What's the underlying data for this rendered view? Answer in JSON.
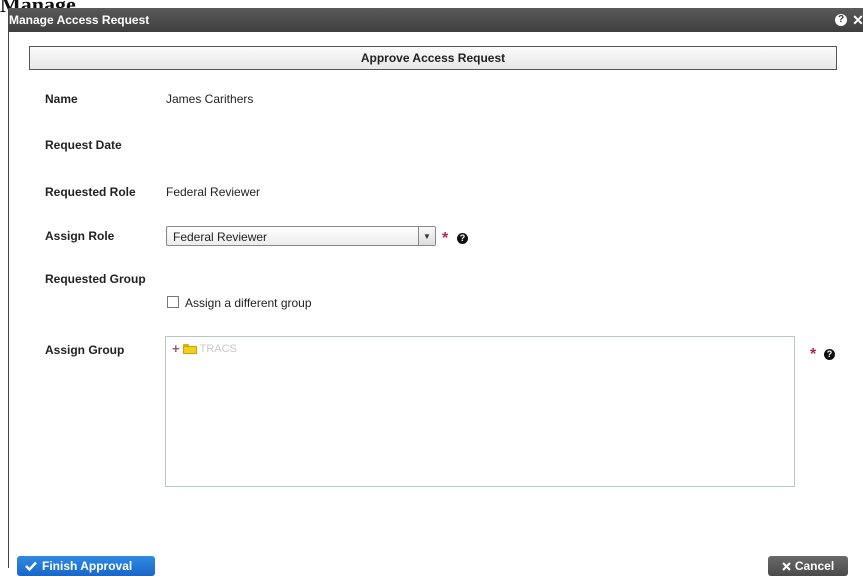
{
  "page": {
    "background_title": "Manage"
  },
  "dialog": {
    "title": "Manage Access Request",
    "help_glyph": "?",
    "close_glyph": "✕"
  },
  "section": {
    "header": "Approve Access Request"
  },
  "fields": {
    "name_label": "Name",
    "name_value": "James Carithers",
    "request_date_label": "Request Date",
    "request_date_value": "",
    "requested_role_label": "Requested Role",
    "requested_role_value": "Federal Reviewer",
    "assign_role_label": "Assign Role",
    "assign_role_selected": "Federal Reviewer",
    "requested_group_label": "Requested Group",
    "assign_different_group_label": "Assign a different group",
    "assign_group_label": "Assign Group"
  },
  "tree": {
    "items": [
      {
        "label": "TRACS",
        "expand_glyph": "+"
      }
    ]
  },
  "buttons": {
    "finish": "Finish Approval",
    "cancel": "Cancel"
  },
  "glyphs": {
    "required": "*",
    "help": "?"
  },
  "colors": {
    "title_bar": "#3e3e3e",
    "primary_button": "#1a66c8",
    "cancel_button": "#4a4a4a",
    "required_star": "#b0265a",
    "folder": "#f1cf1f"
  },
  "icons": [
    "help-icon",
    "close-icon",
    "chevron-down-icon",
    "expand-icon",
    "folder-icon",
    "check-icon",
    "cancel-x-icon"
  ]
}
